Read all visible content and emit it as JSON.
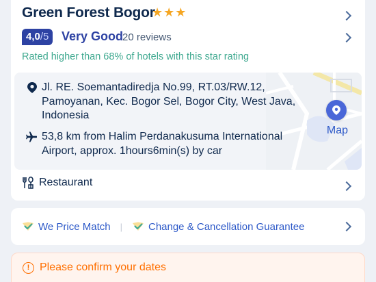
{
  "hotel": {
    "name": "Green Forest Bogor",
    "stars": 3
  },
  "rating": {
    "score": "4,0",
    "out_of": "/5",
    "word": "Very Good",
    "reviews": "20 reviews",
    "rated_higher": "Rated higher than 68% of  hotels with this star rating"
  },
  "location": {
    "address": "Jl. RE. Soemantadiredja No.99, RT.03/RW.12, Pamoyanan, Kec. Bogor Sel, Bogor City, West Java, Indonesia",
    "airport": "53,8 km from Halim Perdanakusuma International Airport, approx. 1hours6min(s) by car",
    "map_label": "Map"
  },
  "facilities": {
    "restaurant": "Restaurant"
  },
  "guarantees": {
    "price_match": "We Price Match",
    "separator": "|",
    "cancellation": "Change & Cancellation Guarantee"
  },
  "dates": {
    "prompt": "Please confirm your dates"
  },
  "colors": {
    "brand_blue": "#2d42a3",
    "link_blue": "#2d59c8",
    "green": "#3fa990",
    "star": "#f5a623",
    "warning": "#ff6f00"
  }
}
